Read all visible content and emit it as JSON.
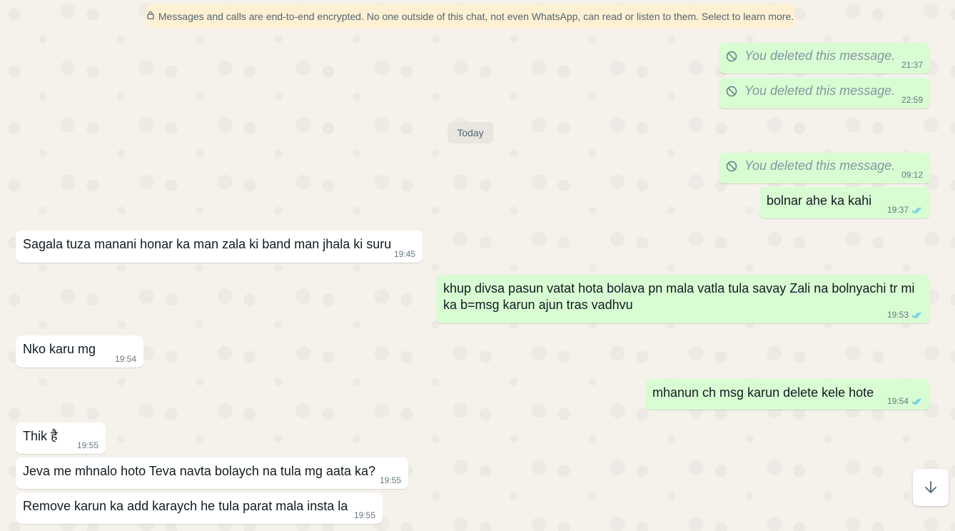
{
  "banner": {
    "text": "Messages and calls are end-to-end encrypted. No one outside of this chat, not even WhatsApp, can read or listen to them. Select to learn more."
  },
  "day_separator": "Today",
  "messages": [
    {
      "dir": "out",
      "deleted": true,
      "text": "You deleted this message.",
      "time": "21:37"
    },
    {
      "dir": "out",
      "deleted": true,
      "text": "You deleted this message.",
      "time": "22:59"
    },
    {
      "dir": "out",
      "deleted": true,
      "text": "You deleted this message.",
      "time": "09:12"
    },
    {
      "dir": "out",
      "text": "bolnar ahe ka kahi",
      "time": "19:37",
      "status": "read"
    },
    {
      "dir": "in",
      "text": "Sagala tuza manani honar ka man zala ki band man jhala ki suru",
      "time": "19:45"
    },
    {
      "dir": "out",
      "text": "khup divsa pasun vatat hota bolava pn mala vatla tula savay Zali na bolnyachi tr mi ka b=msg karun ajun tras vadhvu",
      "time": "19:53",
      "status": "read"
    },
    {
      "dir": "in",
      "text": "Nko karu mg",
      "time": "19:54"
    },
    {
      "dir": "out",
      "text": "mhanun ch msg karun delete kele hote",
      "time": "19:54",
      "status": "read"
    },
    {
      "dir": "in",
      "text": "Thik है",
      "time": "19:55"
    },
    {
      "dir": "in",
      "text": "Jeva me mhnalo hoto Teva navta bolaych na tula mg aata ka?",
      "time": "19:55"
    },
    {
      "dir": "in",
      "text": "Remove karun ka add karaych he tula parat mala insta la",
      "time": "19:55"
    }
  ],
  "icons": {
    "lock": "lock-icon",
    "deleted": "ban-icon",
    "read": "double-check-icon",
    "scroll": "arrow-down-icon"
  },
  "colors": {
    "outgoing_bubble": "#d9fdd3",
    "incoming_bubble": "#ffffff",
    "read_ticks": "#53bdeb",
    "banner_bg": "#fdf0d3"
  }
}
